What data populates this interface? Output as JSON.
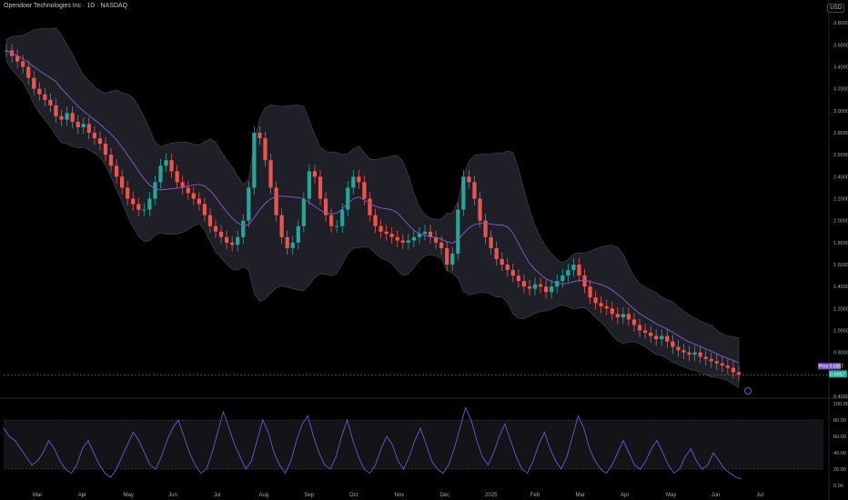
{
  "header": {
    "title": "Opendoor Technologies Inc · 1D · NASDAQ",
    "currency": "USD"
  },
  "chart_data": [
    {
      "type": "candlestick",
      "title": "Opendoor Technologies Inc · 1D · NASDAQ",
      "ylim": [
        0.4,
        3.86
      ],
      "y_ticks": [
        "3.8000",
        "3.6000",
        "3.4000",
        "3.2000",
        "3.0000",
        "2.8000",
        "2.6000",
        "2.4000",
        "2.2000",
        "2.0000",
        "1.8000",
        "1.6000",
        "1.4000",
        "1.2000",
        "1.0000",
        "0.8000",
        "0.4000"
      ],
      "x_ticks": [
        "Mar",
        "Apr",
        "May",
        "Jun",
        "Jul",
        "Aug",
        "Sep",
        "Oct",
        "Nov",
        "Dec",
        "2025",
        "Feb",
        "Mar",
        "Apr",
        "May",
        "Jun",
        "Jul"
      ],
      "series_close": [
        3.55,
        3.5,
        3.45,
        3.4,
        3.3,
        3.2,
        3.15,
        3.1,
        3.05,
        2.95,
        2.92,
        2.98,
        2.9,
        2.85,
        2.88,
        2.8,
        2.75,
        2.7,
        2.6,
        2.5,
        2.4,
        2.3,
        2.2,
        2.15,
        2.1,
        2.1,
        2.2,
        2.35,
        2.5,
        2.55,
        2.45,
        2.35,
        2.3,
        2.25,
        2.2,
        2.15,
        2.05,
        1.95,
        1.9,
        1.85,
        1.8,
        1.78,
        1.85,
        2.0,
        2.3,
        2.8,
        2.75,
        2.55,
        2.3,
        2.05,
        1.85,
        1.75,
        1.8,
        1.95,
        2.2,
        2.45,
        2.4,
        2.2,
        2.05,
        1.95,
        1.95,
        2.1,
        2.3,
        2.4,
        2.35,
        2.2,
        2.05,
        1.95,
        1.9,
        1.88,
        1.85,
        1.82,
        1.8,
        1.82,
        1.85,
        1.88,
        1.9,
        1.85,
        1.8,
        1.75,
        1.6,
        1.7,
        2.1,
        2.4,
        2.35,
        2.2,
        2.0,
        1.85,
        1.75,
        1.65,
        1.6,
        1.55,
        1.5,
        1.45,
        1.4,
        1.38,
        1.42,
        1.4,
        1.35,
        1.4,
        1.45,
        1.5,
        1.55,
        1.6,
        1.5,
        1.4,
        1.3,
        1.25,
        1.22,
        1.2,
        1.15,
        1.12,
        1.15,
        1.1,
        1.05,
        1.0,
        0.98,
        0.95,
        0.92,
        0.95,
        0.9,
        0.85,
        0.82,
        0.8,
        0.78,
        0.8,
        0.76,
        0.74,
        0.72,
        0.7,
        0.68,
        0.66,
        0.62,
        0.6
      ],
      "last_price": "0.5957",
      "last_label": "Prev",
      "prev_value": "0.5957",
      "bollinger": true,
      "colors": {
        "up": "#26a69a",
        "down": "#ef5350",
        "ma": "#7e57c2",
        "band": "#1f1f27"
      }
    },
    {
      "type": "line",
      "title": "",
      "ylim": [
        0,
        100
      ],
      "y_ticks": [
        "100.00",
        "80.00",
        "60.00",
        "40.00",
        "20.00",
        "0.00"
      ],
      "levels": [
        80,
        20
      ],
      "values": [
        70,
        60,
        55,
        45,
        35,
        25,
        30,
        40,
        55,
        45,
        30,
        20,
        15,
        25,
        45,
        55,
        40,
        25,
        15,
        10,
        20,
        35,
        50,
        65,
        55,
        40,
        25,
        20,
        35,
        55,
        70,
        80,
        60,
        40,
        25,
        15,
        20,
        40,
        65,
        90,
        70,
        50,
        35,
        20,
        30,
        55,
        80,
        65,
        40,
        25,
        15,
        30,
        55,
        75,
        85,
        60,
        40,
        25,
        20,
        35,
        60,
        80,
        55,
        35,
        20,
        15,
        25,
        45,
        60,
        50,
        30,
        20,
        35,
        55,
        70,
        50,
        30,
        20,
        15,
        25,
        45,
        70,
        95,
        80,
        55,
        35,
        25,
        40,
        60,
        75,
        55,
        35,
        20,
        15,
        30,
        50,
        65,
        45,
        30,
        20,
        35,
        60,
        85,
        70,
        45,
        30,
        20,
        15,
        25,
        40,
        55,
        40,
        25,
        20,
        30,
        45,
        55,
        40,
        25,
        15,
        20,
        35,
        45,
        30,
        20,
        25,
        40,
        30,
        20,
        15,
        10,
        8
      ],
      "color": "#5a5fd0"
    }
  ]
}
